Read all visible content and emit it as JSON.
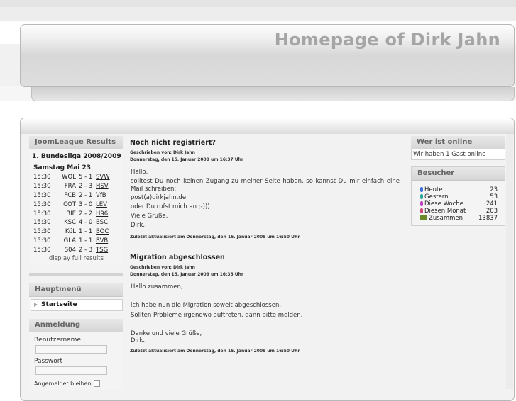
{
  "header": {
    "site_title": "Homepage of Dirk Jahn"
  },
  "results": {
    "title": "JoomLeague Results",
    "league": "1. Bundesliga 2008/2009",
    "matchday": "Samstag Mai 23",
    "matches": [
      {
        "time": "15:30",
        "home": "WOL",
        "score": "5 - 1",
        "away": "SVW"
      },
      {
        "time": "15:30",
        "home": "FRA",
        "score": "2 - 3",
        "away": "HSV"
      },
      {
        "time": "15:30",
        "home": "FCB",
        "score": "2 - 1",
        "away": "VfB"
      },
      {
        "time": "15:30",
        "home": "COT",
        "score": "3 - 0",
        "away": "LEV"
      },
      {
        "time": "15:30",
        "home": "BIE",
        "score": "2 - 2",
        "away": "H96"
      },
      {
        "time": "15:30",
        "home": "KSC",
        "score": "4 - 0",
        "away": "BSC"
      },
      {
        "time": "15:30",
        "home": "KöL",
        "score": "1 - 1",
        "away": "BOC"
      },
      {
        "time": "15:30",
        "home": "GLA",
        "score": "1 - 1",
        "away": "BVB"
      },
      {
        "time": "15:30",
        "home": "S04",
        "score": "2 - 3",
        "away": "TSG"
      }
    ],
    "full_link": "display full results"
  },
  "mainmenu": {
    "title": "Hauptmenü",
    "items": [
      {
        "label": "Startseite"
      }
    ]
  },
  "login": {
    "title": "Anmeldung",
    "username_label": "Benutzername",
    "password_label": "Passwort",
    "remember_label": "Angemeldet bleiben"
  },
  "articles": [
    {
      "title": "Noch nicht registriert?",
      "author": "Geschrieben von: Dirk Jahn",
      "date": "Donnerstag, den 15. Januar 2009 um 16:37 Uhr",
      "paragraphs": [
        "Hallo,",
        "solltest Du noch keinen Zugang zu meiner Seite haben, so kannst Du mir einfach eine Mail schreiben:",
        "post(a)dirkjahn.de",
        "oder Du rufst mich an ;-)))",
        "Viele Grüße,",
        "Dirk."
      ],
      "updated": "Zuletzt aktualisiert am Donnerstag, den 15. Januar 2009 um 16:50 Uhr"
    },
    {
      "title": "Migration abgeschlossen",
      "author": "Geschrieben von: Dirk Jahn",
      "date": "Donnerstag, den 15. Januar 2009 um 16:35 Uhr",
      "paragraphs": [
        "Hallo zusammen,",
        "ich habe nun die Migration soweit abgeschlossen.",
        "Sollten Probleme irgendwo auftreten, dann bitte melden.",
        "Danke und viele Grüße,",
        "Dirk."
      ],
      "updated": "Zuletzt aktualisiert am Donnerstag, den 15. Januar 2009 um 16:50 Uhr"
    }
  ],
  "online": {
    "title": "Wer ist online",
    "text": "Wir haben 1 Gast online"
  },
  "visitors": {
    "title": "Besucher",
    "rows": [
      {
        "label": "Heute",
        "value": "23",
        "color": "#3a6fd8"
      },
      {
        "label": "Gestern",
        "value": "53",
        "color": "#2aa8a0"
      },
      {
        "label": "Diese Woche",
        "value": "241",
        "color": "#c040c0"
      },
      {
        "label": "Diesen Monat",
        "value": "203",
        "color": "#d04878"
      },
      {
        "label": "Zusammen",
        "value": "13837",
        "color": "#6a8a2a"
      }
    ]
  }
}
